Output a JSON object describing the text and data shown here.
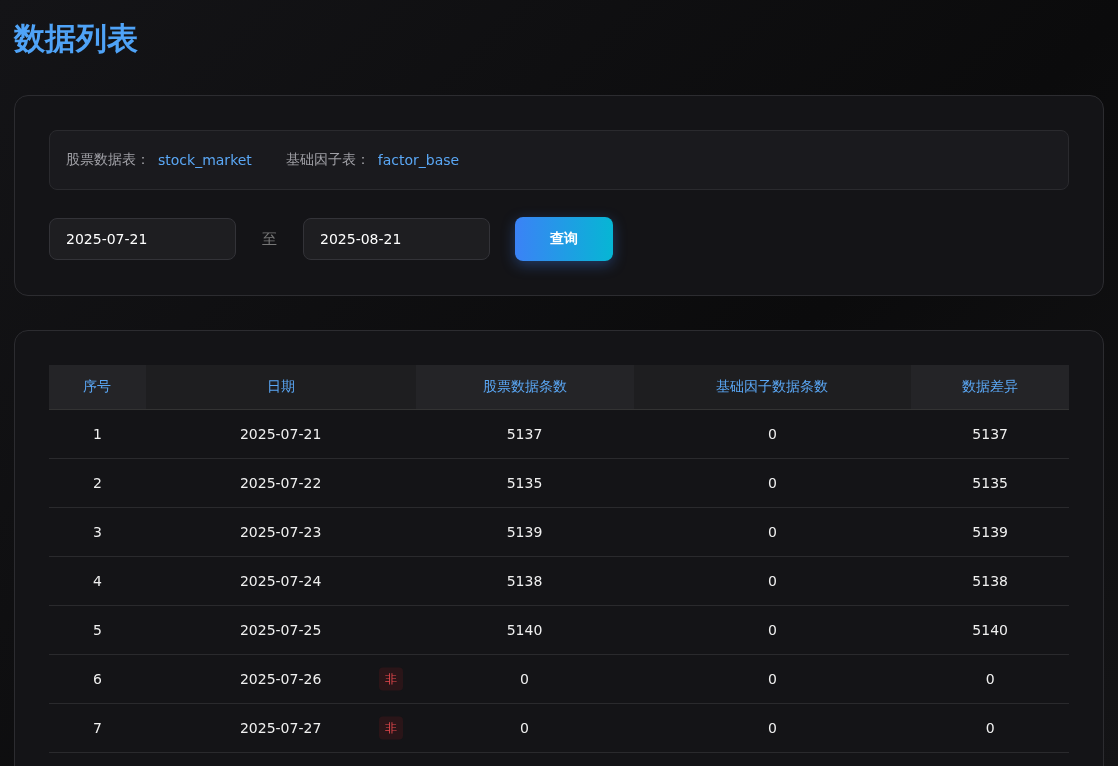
{
  "title": "数据列表",
  "info": [
    {
      "label": "股票数据表：",
      "value": "stock_market"
    },
    {
      "label": "基础因子表：",
      "value": "factor_base"
    }
  ],
  "filter": {
    "start": "2025-07-21",
    "separator": "至",
    "end": "2025-08-21",
    "button": "查询"
  },
  "table": {
    "columns": [
      "序号",
      "日期",
      "股票数据条数",
      "基础因子数据条数",
      "数据差异"
    ],
    "rows": [
      {
        "cells": [
          "1",
          "2025-07-21",
          "5137",
          "0",
          "5137"
        ]
      },
      {
        "cells": [
          "2",
          "2025-07-22",
          "5135",
          "0",
          "5135"
        ]
      },
      {
        "cells": [
          "3",
          "2025-07-23",
          "5139",
          "0",
          "5139"
        ]
      },
      {
        "cells": [
          "4",
          "2025-07-24",
          "5138",
          "0",
          "5138"
        ]
      },
      {
        "cells": [
          "5",
          "2025-07-25",
          "5140",
          "0",
          "5140"
        ]
      },
      {
        "cells": [
          "6",
          "2025-07-26",
          "0",
          "0",
          "0"
        ],
        "tag": "非"
      },
      {
        "cells": [
          "7",
          "2025-07-27",
          "0",
          "0",
          "0"
        ],
        "tag": "非"
      }
    ]
  }
}
